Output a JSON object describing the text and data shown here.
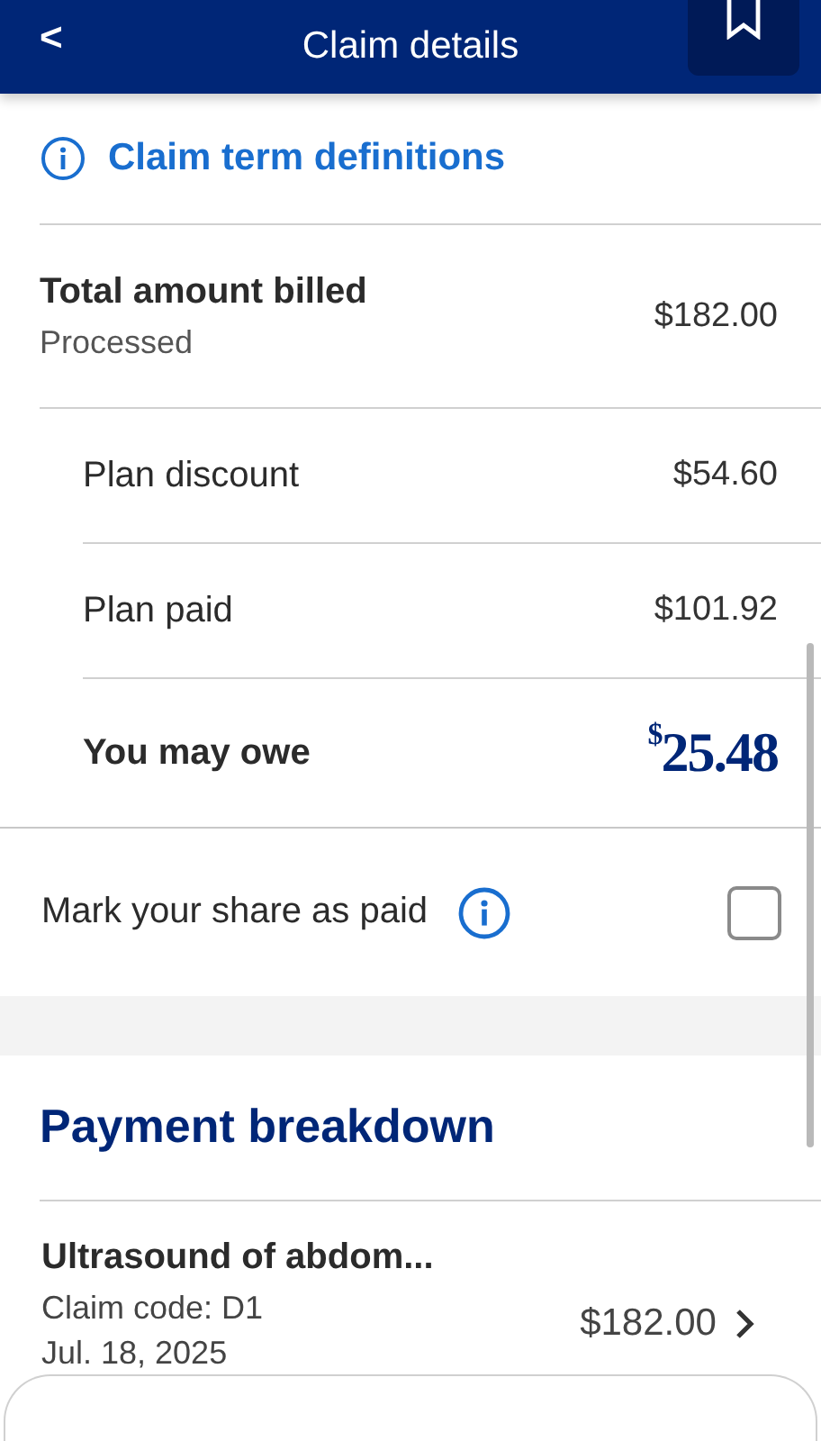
{
  "header": {
    "back_icon": "<",
    "title": "Claim details"
  },
  "definitions_link": {
    "label": "Claim term definitions"
  },
  "total": {
    "label": "Total amount billed",
    "status": "Processed",
    "amount": "$182.00"
  },
  "lines": [
    {
      "kind": "normal",
      "label": "Plan discount",
      "amount": "$54.60"
    },
    {
      "kind": "normal",
      "label": "Plan paid",
      "amount": "$101.92"
    },
    {
      "kind": "owe",
      "label": "You may owe",
      "amount": "$^{$}$25.48"
    }
  ],
  "mark_paid": {
    "label": "Mark your share as paid",
    "checked": false
  },
  "breakdown": {
    "heading": "Payment breakdown",
    "items": [
      {
        "title": "Ultrasound of abdom...",
        "code": "Claim code: D1",
        "date": "Jul. 18, 2025",
        "amount": "$182.00"
      }
    ]
  }
}
